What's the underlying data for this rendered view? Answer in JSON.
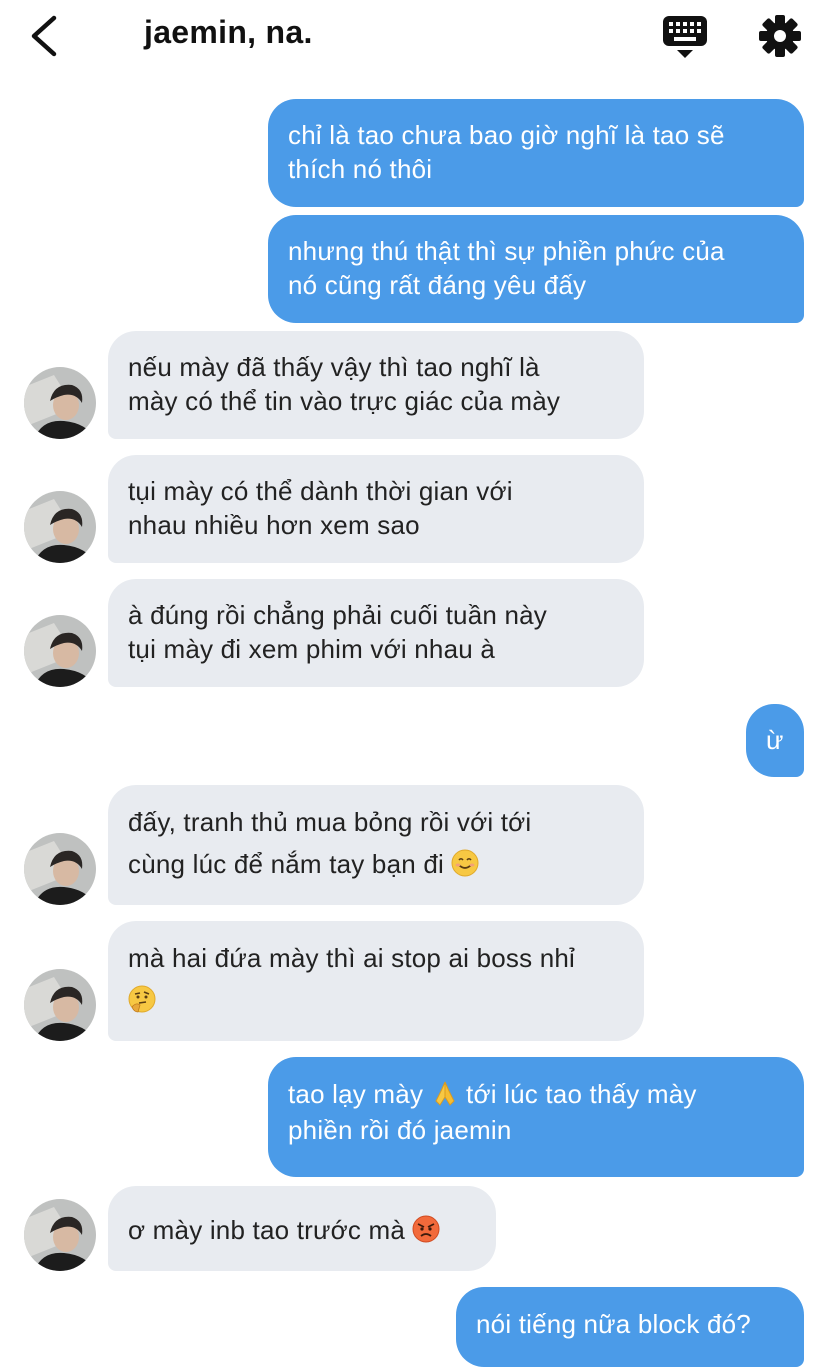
{
  "header": {
    "title": "jaemin, na.",
    "back_icon": "chevron-left-icon",
    "keyboard_icon": "keyboard-icon",
    "settings_icon": "gear-icon"
  },
  "colors": {
    "outgoing_bubble": "#4b9be8",
    "incoming_bubble": "#e8ebf0"
  },
  "messages": [
    {
      "from": "me",
      "lines": [
        "chỉ là tao chưa bao giờ nghĩ là tao sẽ",
        "thích nó thôi"
      ]
    },
    {
      "from": "me",
      "lines": [
        "nhưng thú thật thì sự phiền phức của",
        "nó cũng rất đáng yêu đấy"
      ]
    },
    {
      "from": "them",
      "lines": [
        "nếu mày đã thấy vậy thì tao nghĩ là",
        "mày có thể tin vào trực giác của mày"
      ]
    },
    {
      "from": "them",
      "lines": [
        "tụi mày có thể dành thời gian với",
        "nhau nhiều hơn xem sao"
      ]
    },
    {
      "from": "them",
      "lines": [
        "à đúng rồi chẳng phải cuối tuần này",
        "tụi mày đi xem phim với nhau à"
      ]
    },
    {
      "from": "me",
      "lines": [
        "ừ"
      ]
    },
    {
      "from": "them",
      "lines": [
        "đấy, tranh thủ mua bỏng rồi với tới",
        "cùng lúc để nắm tay bạn đi"
      ],
      "emoji": "smiling-face-emoji"
    },
    {
      "from": "them",
      "lines": [
        "mà hai đứa mày thì ai stop ai boss nhỉ"
      ],
      "emoji": "thinking-face-emoji"
    },
    {
      "from": "me",
      "lines": [
        "tao lạy mày",
        "tới lúc tao thấy mày",
        "phiền rồi đó jaemin"
      ],
      "emoji": "folded-hands-emoji"
    },
    {
      "from": "them",
      "lines": [
        "ơ mày inb tao trước mà"
      ],
      "emoji": "angry-face-emoji"
    },
    {
      "from": "me",
      "lines": [
        "nói tiếng nữa block đó?"
      ]
    }
  ]
}
